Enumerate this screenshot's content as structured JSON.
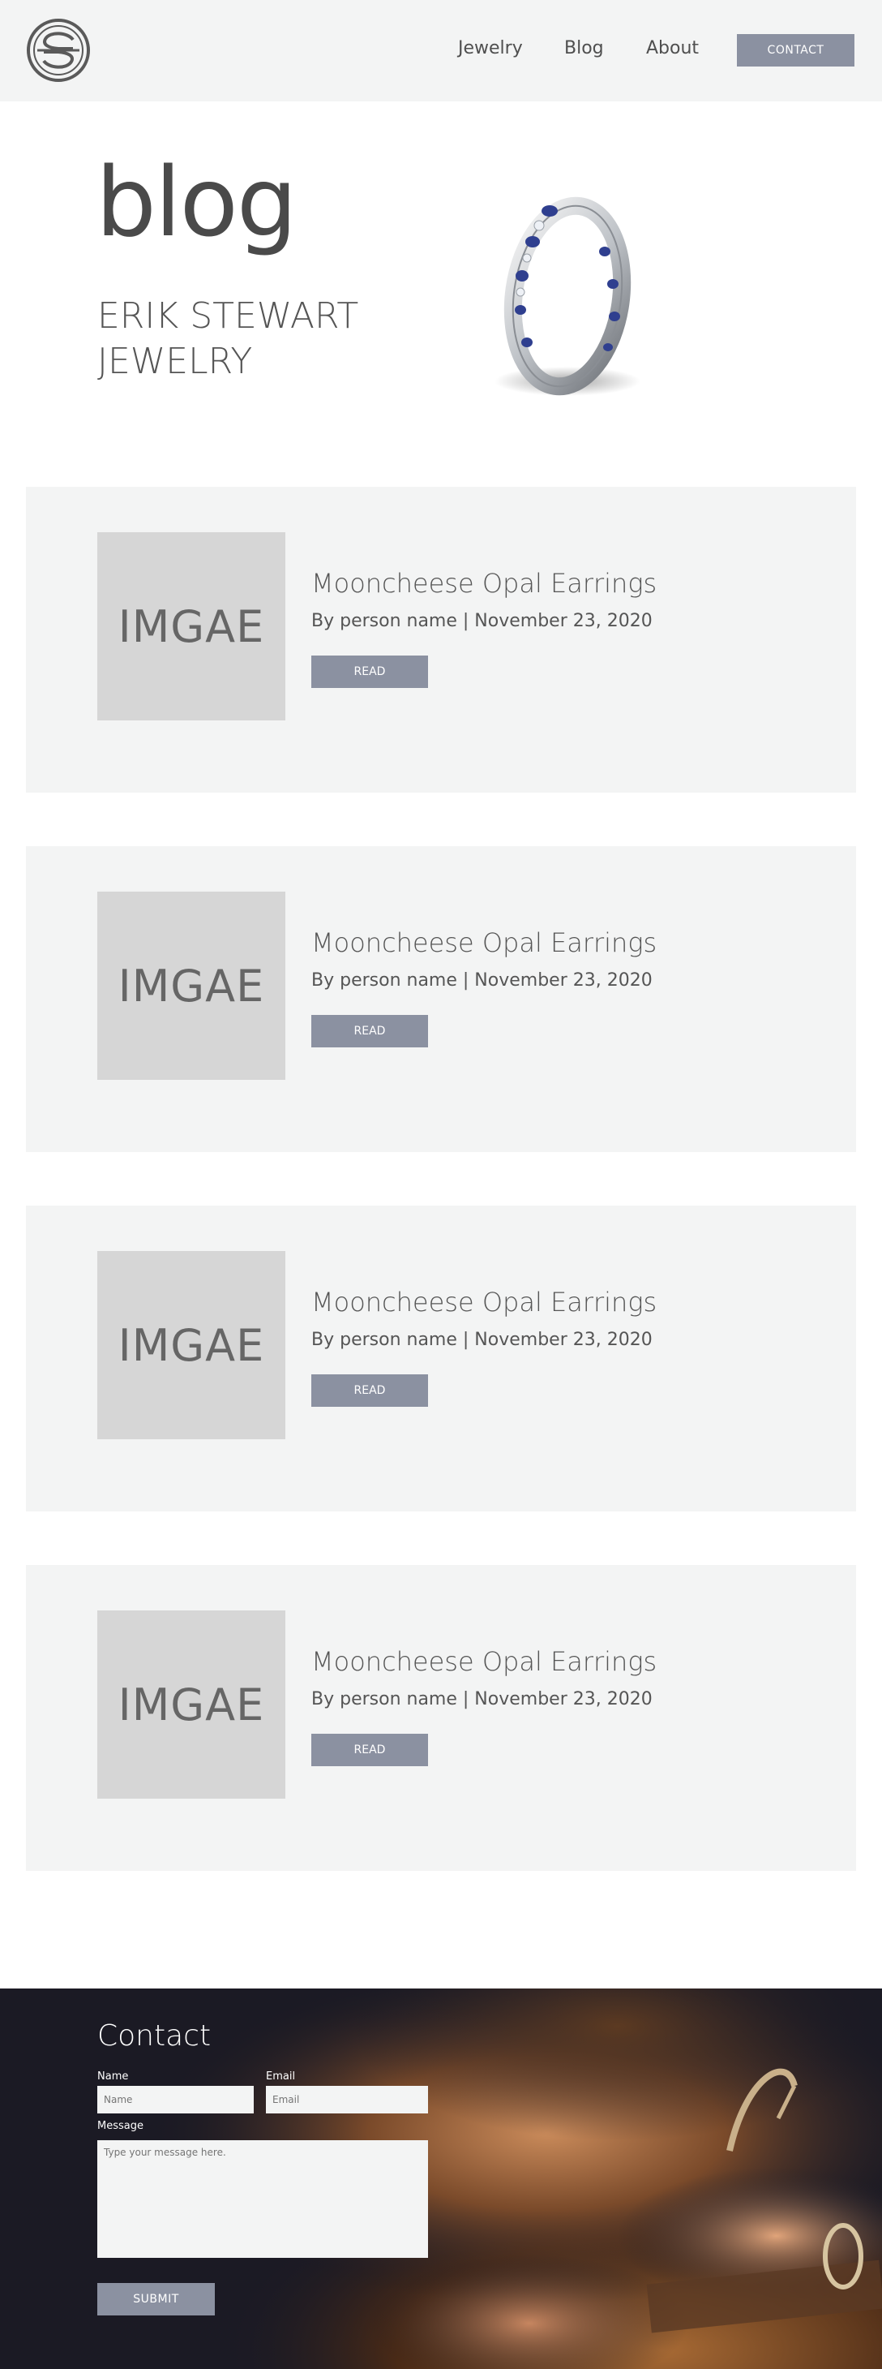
{
  "header": {
    "nav": [
      "Jewelry",
      "Blog",
      "About"
    ],
    "contact_label": "CONTACT"
  },
  "hero": {
    "title": "blog",
    "subtitle_line1": "ERIK STEWART",
    "subtitle_line2": "JEWELRY"
  },
  "posts": [
    {
      "image_text": "IMGAE",
      "title": "Mooncheese Opal Earrings",
      "meta": "By person name |  November 23, 2020",
      "read_label": "READ"
    },
    {
      "image_text": "IMGAE",
      "title": "Mooncheese Opal Earrings",
      "meta": "By person name |  November 23, 2020",
      "read_label": "READ"
    },
    {
      "image_text": "IMGAE",
      "title": "Mooncheese Opal Earrings",
      "meta": "By person name |  November 23, 2020",
      "read_label": "READ"
    },
    {
      "image_text": "IMGAE",
      "title": "Mooncheese Opal Earrings",
      "meta": "By person name |  November 23, 2020",
      "read_label": "READ"
    }
  ],
  "contact": {
    "title": "Contact",
    "name_label": "Name",
    "name_placeholder": "Name",
    "email_label": "Email",
    "email_placeholder": "Email",
    "message_label": "Message",
    "message_placeholder": "Type your message here.",
    "submit_label": "SUBMIT"
  },
  "colors": {
    "header_bg": "#f3f4f4",
    "button": "#8b91a1",
    "card_bg": "#f3f4f4",
    "image_placeholder": "#d6d6d6",
    "contact_bg": "#1b1a24"
  },
  "icons": [
    "logo-icon",
    "ring-image",
    "jeweler-photo"
  ]
}
